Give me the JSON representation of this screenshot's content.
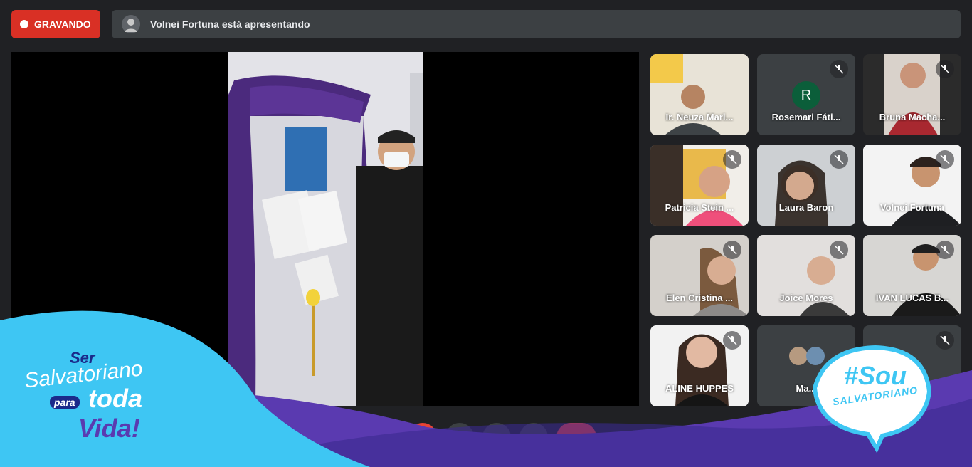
{
  "top_bar": {
    "recording_label": "GRAVANDO",
    "presenter_text": "Volnei Fortuna está apresentando"
  },
  "participants": [
    {
      "name": "Ir. Neuza Mari...",
      "muted": false
    },
    {
      "name": "Rosemari Fáti...",
      "muted": true,
      "initial": "R"
    },
    {
      "name": "Bruna Macha...",
      "muted": true
    },
    {
      "name": "Patricia Stein ...",
      "muted": true
    },
    {
      "name": "Laura Baron",
      "muted": true
    },
    {
      "name": "Volnei Fortuna",
      "muted": true
    },
    {
      "name": "Elen Cristina ...",
      "muted": true
    },
    {
      "name": "Joice Mores",
      "muted": true
    },
    {
      "name": "IVAN LUCAS B...",
      "muted": true
    },
    {
      "name": "ALINE HUPPES",
      "muted": true
    },
    {
      "name": "Ma...",
      "muted": false
    },
    {
      "name": "",
      "muted": true
    }
  ],
  "branding": {
    "left_logo_lines": [
      "Ser",
      "Salvatoriano",
      "para",
      "toda",
      "Vida!"
    ],
    "right_logo_lines": [
      "#Sou",
      "SALVATORIANO"
    ],
    "colors": {
      "cyan": "#3ec6f3",
      "purple": "#5a3ab0",
      "navy": "#1b2a8a",
      "record_red": "#d93025"
    }
  },
  "controls": [
    "mic-off-icon",
    "camera-off-icon",
    "captions-icon",
    "present-icon",
    "more-icon",
    "end-call-icon"
  ]
}
